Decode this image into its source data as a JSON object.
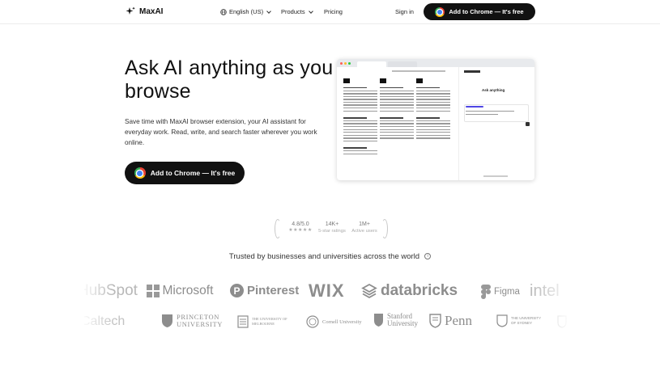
{
  "nav": {
    "brand": "MaxAI",
    "language": "English (US)",
    "products": "Products",
    "pricing": "Pricing",
    "sign_in": "Sign in",
    "cta": "Add to Chrome — It's free"
  },
  "hero": {
    "title": "Ask AI anything as you browse",
    "subtitle": "Save time with MaxAI browser extension, your AI assistant for everyday work. Read, write, and search faster wherever you work online.",
    "cta": "Add to Chrome — It's free"
  },
  "mockup": {
    "panel_title": "Ask anything"
  },
  "stats": [
    {
      "value": "4.8/5.0",
      "sub": "★★★★★"
    },
    {
      "value": "14K+",
      "sub": "5-star ratings"
    },
    {
      "value": "1M+",
      "sub": "Active users"
    }
  ],
  "trusted": "Trusted by businesses and universities across the world",
  "logos_row1": [
    "HubSpot",
    "Microsoft",
    "Pinterest",
    "WIX",
    "databricks",
    "Figma",
    "intel"
  ],
  "logos_row2": [
    "Caltech",
    "PRINCETON UNIVERSITY",
    "THE UNIVERSITY OF MELBOURNE",
    "Cornell University",
    "Stanford University",
    "Penn",
    "THE UNIVERSITY OF SYDNEY"
  ],
  "colors": {
    "brand_dark": "#111111",
    "logo_gray": "#8d8d8d"
  }
}
